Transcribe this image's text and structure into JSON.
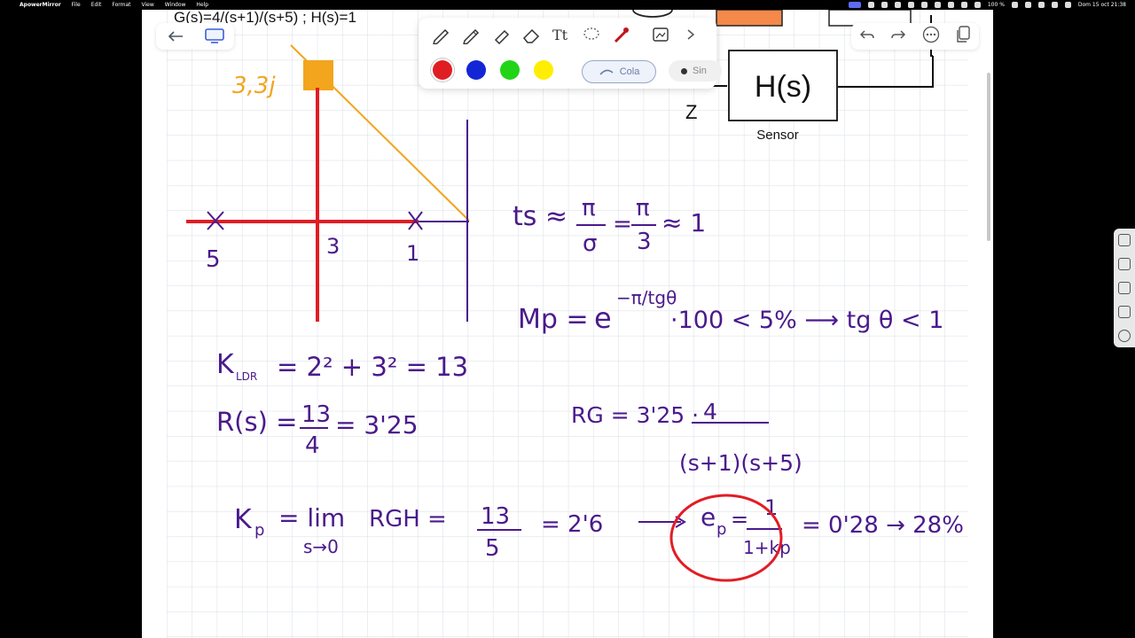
{
  "menubar": {
    "app_name": "ApowerMirror",
    "menus": [
      "File",
      "Edit",
      "Format",
      "View",
      "Window",
      "Help"
    ],
    "datetime": "Dom 15 oct 21:38",
    "battery": "100 %"
  },
  "document": {
    "header_formula": "G(s)=4/(s+1)/(s+5)  ;      H(s)=1",
    "block_label": "H(s)",
    "z_label": "Z",
    "sensor_label": "Sensor"
  },
  "toolbar_left": {
    "back_icon": "arrow-left-icon",
    "screen_icon": "screen-icon"
  },
  "tools": {
    "items": [
      "pen-icon",
      "pencil-icon",
      "highlighter-icon",
      "eraser-icon",
      "text-icon",
      "lasso-icon",
      "laser-pointer-icon",
      "image-scan-icon",
      "chevron-right-icon"
    ],
    "colors": [
      "#e11d24",
      "#1326d6",
      "#22d416",
      "#ffee00"
    ],
    "tail_label": "Cola",
    "thickness_label": "Sin"
  },
  "toolbar_right": {
    "items": [
      "undo-icon",
      "redo-icon",
      "more-icon",
      "copy-icon"
    ]
  },
  "handwriting": {
    "pole_point": "3,3j",
    "axis_label_5": "5",
    "axis_label_3": "3",
    "axis_label_1": "1",
    "ts_lhs": "ts ≈",
    "ts_pi1": "π",
    "ts_sigma": "σ",
    "ts_eq": "=",
    "ts_pi2": "π",
    "ts_3": "3",
    "ts_approx": "≈ 1",
    "mp_lhs": "Mp =",
    "mp_e": "e",
    "mp_exp": "−π/tgθ",
    "mp_rest": "·100 < 5% ⟶ tg θ < 1",
    "k_ldr": "K",
    "k_sub": "LDR",
    "k_eq": "= 2² + 3² = 13",
    "r_lhs": "R(s) =",
    "r_num": "13",
    "r_den": "4",
    "r_res": "= 3'25",
    "rg_lhs": "RG = 3'25 ·",
    "rg_num": "4",
    "rg_den": "(s+1)(s+5)",
    "kp_lhs": "K",
    "kp_sub": "p",
    "kp_eq": "= lim",
    "kp_lim": "s→0",
    "kp_rgh": "RGH =",
    "kp_num": "13",
    "kp_den": "5",
    "kp_res": "= 2'6",
    "ep_lhs": "e",
    "ep_sub": "p",
    "ep_eq": "=",
    "ep_num": "1",
    "ep_den": "1+kp",
    "ep_res": "= 0'28 → 28%"
  },
  "side_panel": {
    "items": [
      "expand-icon",
      "camera-icon",
      "record-icon",
      "edit-icon",
      "rotate-icon"
    ]
  }
}
